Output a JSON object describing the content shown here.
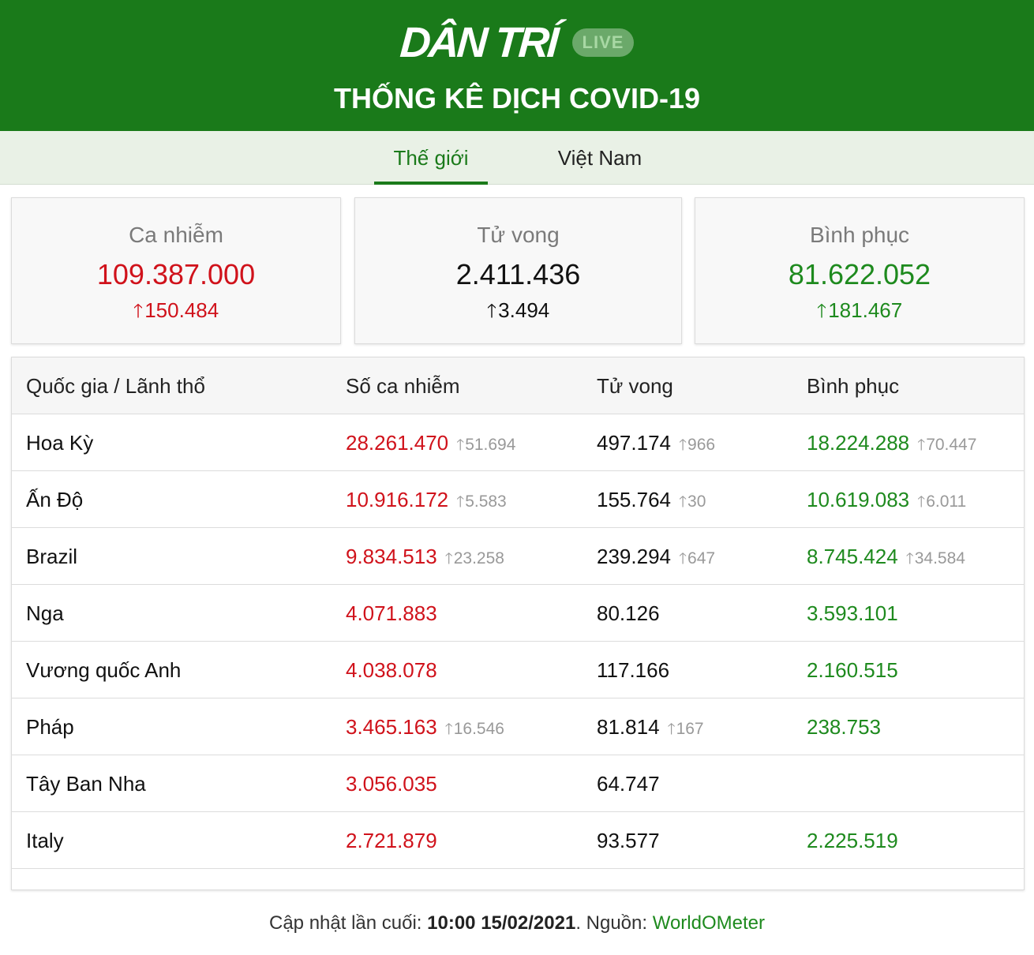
{
  "header": {
    "logo": "DÂN TRÍ",
    "live": "LIVE",
    "title": "THỐNG KÊ DỊCH COVID-19"
  },
  "tabs": [
    {
      "label": "Thế giới",
      "active": true
    },
    {
      "label": "Việt Nam",
      "active": false
    }
  ],
  "summary": [
    {
      "label": "Ca nhiễm",
      "value": "109.387.000",
      "delta": "150.484",
      "color": "#d0121b"
    },
    {
      "label": "Tử vong",
      "value": "2.411.436",
      "delta": "3.494",
      "color": "#111111"
    },
    {
      "label": "Bình phục",
      "value": "81.622.052",
      "delta": "181.467",
      "color": "#1e8a1e"
    }
  ],
  "table": {
    "headers": [
      "Quốc gia / Lãnh thổ",
      "Số ca nhiễm",
      "Tử vong",
      "Bình phục"
    ],
    "rows": [
      {
        "country": "Hoa Kỳ",
        "cases": "28.261.470",
        "cases_delta": "51.694",
        "deaths": "497.174",
        "deaths_delta": "966",
        "recovered": "18.224.288",
        "recovered_delta": "70.447"
      },
      {
        "country": "Ấn Độ",
        "cases": "10.916.172",
        "cases_delta": "5.583",
        "deaths": "155.764",
        "deaths_delta": "30",
        "recovered": "10.619.083",
        "recovered_delta": "6.011"
      },
      {
        "country": "Brazil",
        "cases": "9.834.513",
        "cases_delta": "23.258",
        "deaths": "239.294",
        "deaths_delta": "647",
        "recovered": "8.745.424",
        "recovered_delta": "34.584"
      },
      {
        "country": "Nga",
        "cases": "4.071.883",
        "cases_delta": "",
        "deaths": "80.126",
        "deaths_delta": "",
        "recovered": "3.593.101",
        "recovered_delta": ""
      },
      {
        "country": "Vương quốc Anh",
        "cases": "4.038.078",
        "cases_delta": "",
        "deaths": "117.166",
        "deaths_delta": "",
        "recovered": "2.160.515",
        "recovered_delta": ""
      },
      {
        "country": "Pháp",
        "cases": "3.465.163",
        "cases_delta": "16.546",
        "deaths": "81.814",
        "deaths_delta": "167",
        "recovered": "238.753",
        "recovered_delta": ""
      },
      {
        "country": "Tây Ban Nha",
        "cases": "3.056.035",
        "cases_delta": "",
        "deaths": "64.747",
        "deaths_delta": "",
        "recovered": "",
        "recovered_delta": ""
      },
      {
        "country": "Italy",
        "cases": "2.721.879",
        "cases_delta": "",
        "deaths": "93.577",
        "deaths_delta": "",
        "recovered": "2.225.519",
        "recovered_delta": ""
      }
    ]
  },
  "footer": {
    "prefix": "Cập nhật lần cuối: ",
    "time": "10:00 15/02/2021",
    "middle": ". Nguồn: ",
    "source": "WorldOMeter"
  },
  "icons": {
    "delta": "arrow-up-icon"
  },
  "colors": {
    "brand": "#1a7a1a",
    "cases": "#d0121b",
    "recovered": "#1e8a1e",
    "delta_muted": "#999999"
  }
}
